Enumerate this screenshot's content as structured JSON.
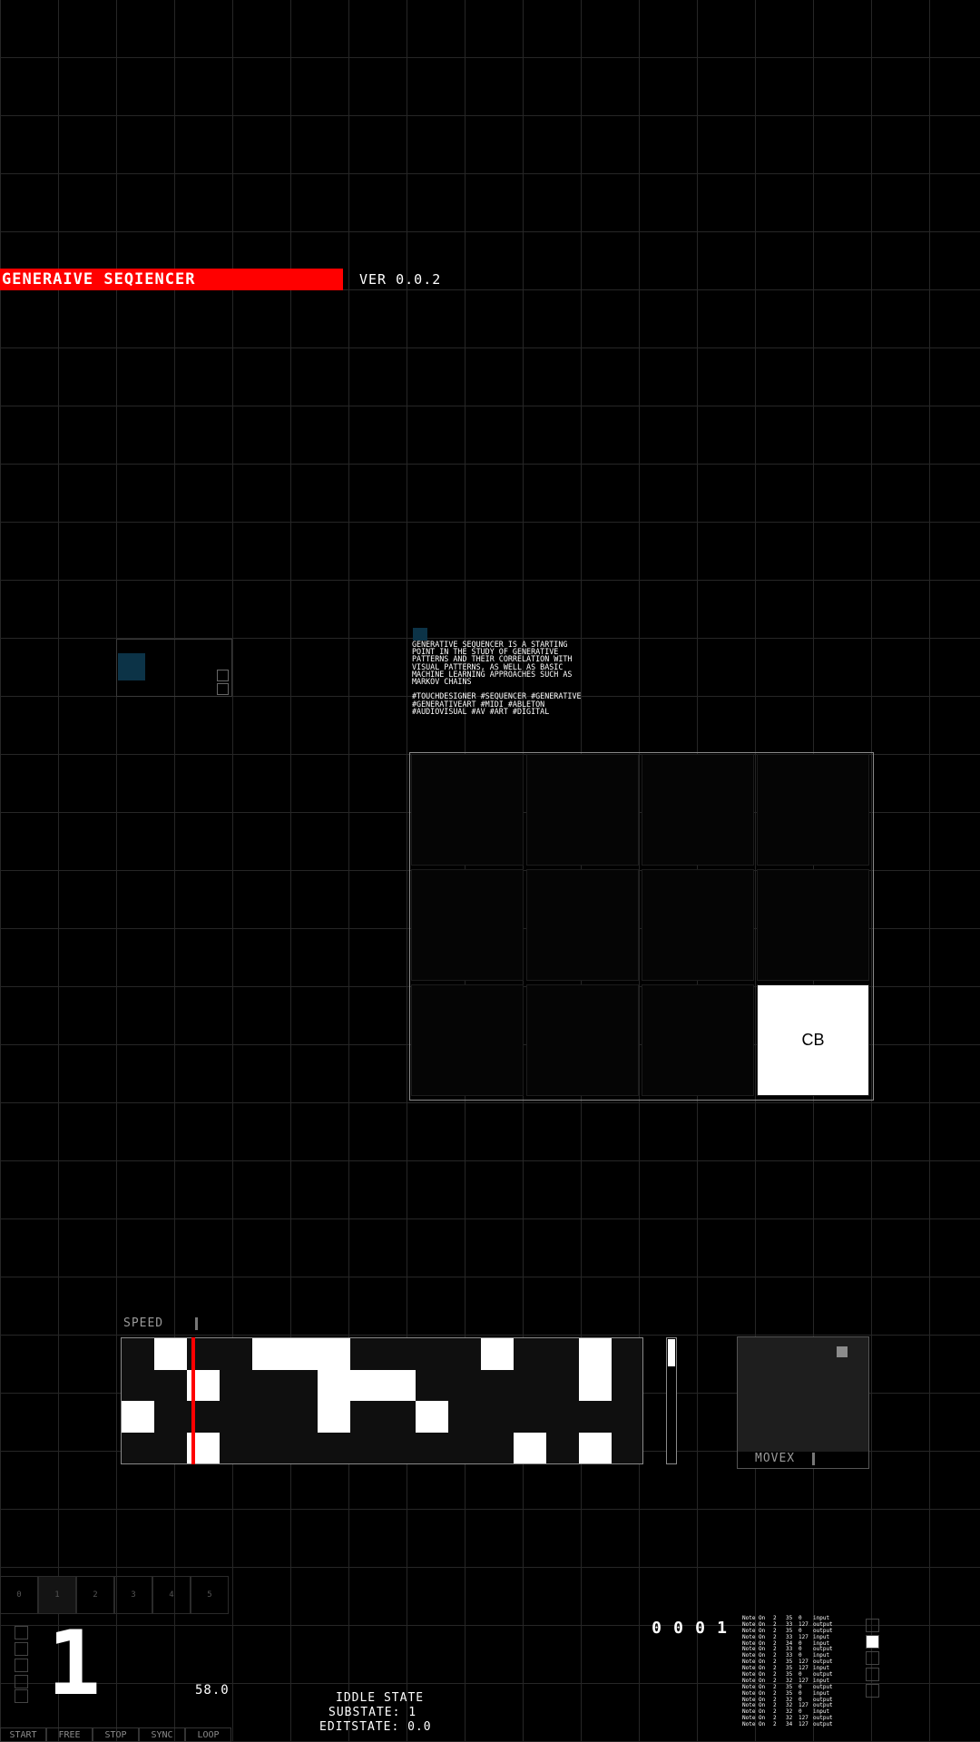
{
  "header": {
    "title": "GENERAIVE SEQIENCER",
    "version": "VER 0.0.2"
  },
  "description": {
    "text": "GENERATIVE SEQUENCER IS A STARTING POINT IN THE STUDY OF GENERATIVE PATTERNS AND THEIR CORRELATION WITH VISUAL PATTERNS, AS WELL AS BASIC MACHINE LEARNING APPROACHES SUCH AS MARKOV CHAINS",
    "tags": "#TOUCHDESIGNER #SEQUENCER #GENERATIVE #GENERATIVEART #MIDI #ABLETON #AUDIOVISUAL #AV #ART #DIGITAL"
  },
  "pad_grid": {
    "rows": 3,
    "cols": 4,
    "active_index": 11,
    "active_label": "CB"
  },
  "sequencer": {
    "speed_label": "SPEED",
    "rows": 4,
    "steps": 15,
    "playhead_step": 1,
    "pattern": [
      [
        0,
        1,
        0,
        0,
        1,
        1,
        1,
        0,
        0,
        0,
        0,
        1,
        0,
        0,
        1
      ],
      [
        0,
        0,
        1,
        0,
        0,
        0,
        1,
        1,
        1,
        0,
        0,
        0,
        0,
        0,
        1
      ],
      [
        1,
        0,
        0,
        0,
        0,
        0,
        1,
        0,
        0,
        1,
        0,
        0,
        0,
        0,
        0
      ],
      [
        0,
        0,
        1,
        0,
        0,
        0,
        0,
        0,
        0,
        0,
        0,
        0,
        1,
        0,
        1
      ]
    ]
  },
  "movex": {
    "label": "MOVEX"
  },
  "presets": {
    "items": [
      "0",
      "1",
      "2",
      "3",
      "4",
      "5"
    ],
    "selected": 1
  },
  "current_pattern": "1",
  "bpm": "58.0",
  "transport": [
    "START",
    "FREE",
    "STOP",
    "SYNC",
    "LOOP"
  ],
  "state": {
    "line1": "IDDLE STATE",
    "line2": "SUBSTATE: 1",
    "line3": "EDITSTATE: 0.0"
  },
  "counter": [
    "0",
    "0",
    "0",
    "1"
  ],
  "midi_log": [
    {
      "msg": "Note On",
      "ch": "2",
      "note": "35",
      "vel": "0",
      "dir": "input"
    },
    {
      "msg": "Note On",
      "ch": "2",
      "note": "33",
      "vel": "127",
      "dir": "output"
    },
    {
      "msg": "Note On",
      "ch": "2",
      "note": "35",
      "vel": "0",
      "dir": "output"
    },
    {
      "msg": "Note On",
      "ch": "2",
      "note": "33",
      "vel": "127",
      "dir": "input"
    },
    {
      "msg": "Note On",
      "ch": "2",
      "note": "34",
      "vel": "0",
      "dir": "input"
    },
    {
      "msg": "Note On",
      "ch": "2",
      "note": "33",
      "vel": "0",
      "dir": "output"
    },
    {
      "msg": "Note On",
      "ch": "2",
      "note": "33",
      "vel": "0",
      "dir": "input"
    },
    {
      "msg": "Note On",
      "ch": "2",
      "note": "35",
      "vel": "127",
      "dir": "output"
    },
    {
      "msg": "Note On",
      "ch": "2",
      "note": "35",
      "vel": "127",
      "dir": "input"
    },
    {
      "msg": "Note On",
      "ch": "2",
      "note": "35",
      "vel": "0",
      "dir": "output"
    },
    {
      "msg": "Note On",
      "ch": "2",
      "note": "32",
      "vel": "127",
      "dir": "input"
    },
    {
      "msg": "Note On",
      "ch": "2",
      "note": "35",
      "vel": "0",
      "dir": "output"
    },
    {
      "msg": "Note On",
      "ch": "2",
      "note": "35",
      "vel": "0",
      "dir": "input"
    },
    {
      "msg": "Note On",
      "ch": "2",
      "note": "32",
      "vel": "0",
      "dir": "output"
    },
    {
      "msg": "Note On",
      "ch": "2",
      "note": "32",
      "vel": "127",
      "dir": "output"
    },
    {
      "msg": "Note On",
      "ch": "2",
      "note": "32",
      "vel": "0",
      "dir": "input"
    },
    {
      "msg": "Note On",
      "ch": "2",
      "note": "32",
      "vel": "127",
      "dir": "output"
    },
    {
      "msg": "Note On",
      "ch": "2",
      "note": "34",
      "vel": "127",
      "dir": "output"
    }
  ],
  "right_stack": {
    "count": 5,
    "active": 1
  },
  "colors": {
    "accent": "#ff0000",
    "swatch": "#0c3347",
    "grid": "#262626"
  }
}
